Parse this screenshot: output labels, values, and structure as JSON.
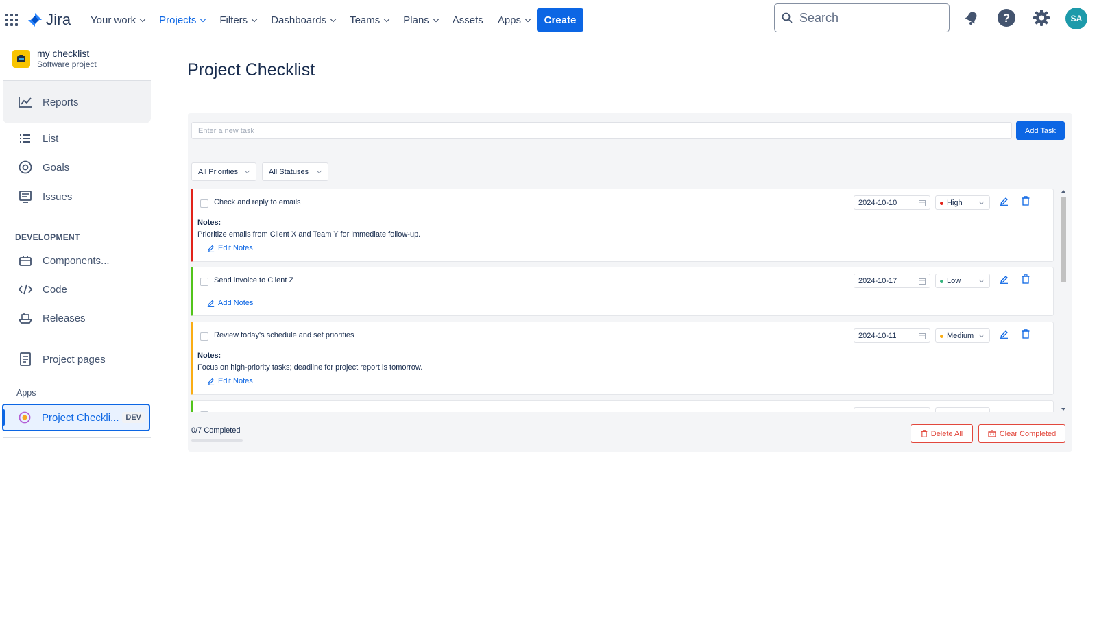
{
  "topnav": {
    "logo_text": "Jira",
    "items": [
      {
        "label": "Your work",
        "dropdown": true,
        "active": false
      },
      {
        "label": "Projects",
        "dropdown": true,
        "active": true
      },
      {
        "label": "Filters",
        "dropdown": true,
        "active": false
      },
      {
        "label": "Dashboards",
        "dropdown": true,
        "active": false
      },
      {
        "label": "Teams",
        "dropdown": true,
        "active": false
      },
      {
        "label": "Plans",
        "dropdown": true,
        "active": false
      },
      {
        "label": "Assets",
        "dropdown": false,
        "active": false
      },
      {
        "label": "Apps",
        "dropdown": true,
        "active": false
      }
    ],
    "create_label": "Create",
    "search_placeholder": "Search",
    "avatar_initials": "SA",
    "icons": [
      "notifications-icon",
      "help-icon",
      "settings-icon"
    ]
  },
  "sidebar": {
    "project_name": "my checklist",
    "project_type": "Software project",
    "items_top": [
      {
        "label": "Reports",
        "icon": "reports-icon"
      },
      {
        "label": "List",
        "icon": "list-icon"
      },
      {
        "label": "Goals",
        "icon": "goals-icon"
      },
      {
        "label": "Issues",
        "icon": "issues-icon"
      }
    ],
    "section_development": "DEVELOPMENT",
    "items_dev": [
      {
        "label": "Components...",
        "icon": "components-icon"
      },
      {
        "label": "Code",
        "icon": "code-icon"
      },
      {
        "label": "Releases",
        "icon": "releases-icon"
      }
    ],
    "project_pages_label": "Project pages",
    "section_apps": "Apps",
    "active_app": {
      "label": "Project Checkli...",
      "badge": "DEV"
    }
  },
  "main": {
    "title": "Project Checklist",
    "new_task_placeholder": "Enter a new task",
    "add_task_label": "Add Task",
    "filter_priority": "All Priorities",
    "filter_status": "All Statuses",
    "tasks": [
      {
        "title": "Check and reply to emails",
        "date": "2024-10-10",
        "priority": "High",
        "priority_color": "#e2231a",
        "border_color": "#e2231a",
        "notes_label": "Notes:",
        "notes": "Prioritize emails from Client X and Team Y for immediate follow-up.",
        "notes_action": "Edit Notes"
      },
      {
        "title": "Send invoice to Client Z",
        "date": "2024-10-17",
        "priority": "Low",
        "priority_color": "#36b37e",
        "border_color": "#52c41a",
        "notes_action": "Add Notes"
      },
      {
        "title": "Review today's schedule and set priorities",
        "date": "2024-10-11",
        "priority": "Medium",
        "priority_color": "#faad14",
        "border_color": "#faad14",
        "notes_label": "Notes:",
        "notes": "Focus on high-priority tasks; deadline for project report is tomorrow.",
        "notes_action": "Edit Notes"
      }
    ],
    "progress_text": "0/7 Completed",
    "progress_fraction": 0,
    "delete_all_label": "Delete All",
    "clear_completed_label": "Clear Completed"
  }
}
